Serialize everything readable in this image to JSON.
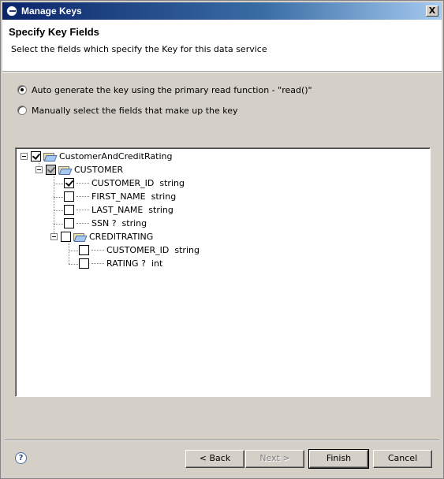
{
  "window": {
    "title": "Manage Keys",
    "close_glyph": "X"
  },
  "banner": {
    "heading": "Specify Key Fields",
    "description": "Select the fields which specify the Key for this data service"
  },
  "options": {
    "auto": {
      "label": "Auto generate the key using the primary read function - \"read()\"",
      "selected": true
    },
    "manual": {
      "label": "Manually select the fields that make up the key",
      "selected": false
    }
  },
  "tree": {
    "root": {
      "label": "CustomerAndCreditRating",
      "checked": true
    },
    "customer": {
      "label": "CUSTOMER",
      "state": "grayed"
    },
    "customer_fields": [
      {
        "label": "CUSTOMER_ID  string",
        "checked": true
      },
      {
        "label": "FIRST_NAME  string",
        "checked": false
      },
      {
        "label": "LAST_NAME  string",
        "checked": false
      },
      {
        "label": "SSN ?  string",
        "checked": false
      }
    ],
    "creditrating": {
      "label": "CREDITRATING",
      "checked": false
    },
    "creditrating_fields": [
      {
        "label": "CUSTOMER_ID  string",
        "checked": false
      },
      {
        "label": "RATING ?  int",
        "checked": false
      }
    ]
  },
  "buttons": {
    "help_glyph": "?",
    "back": "< Back",
    "next": "Next >",
    "finish": "Finish",
    "cancel": "Cancel"
  }
}
